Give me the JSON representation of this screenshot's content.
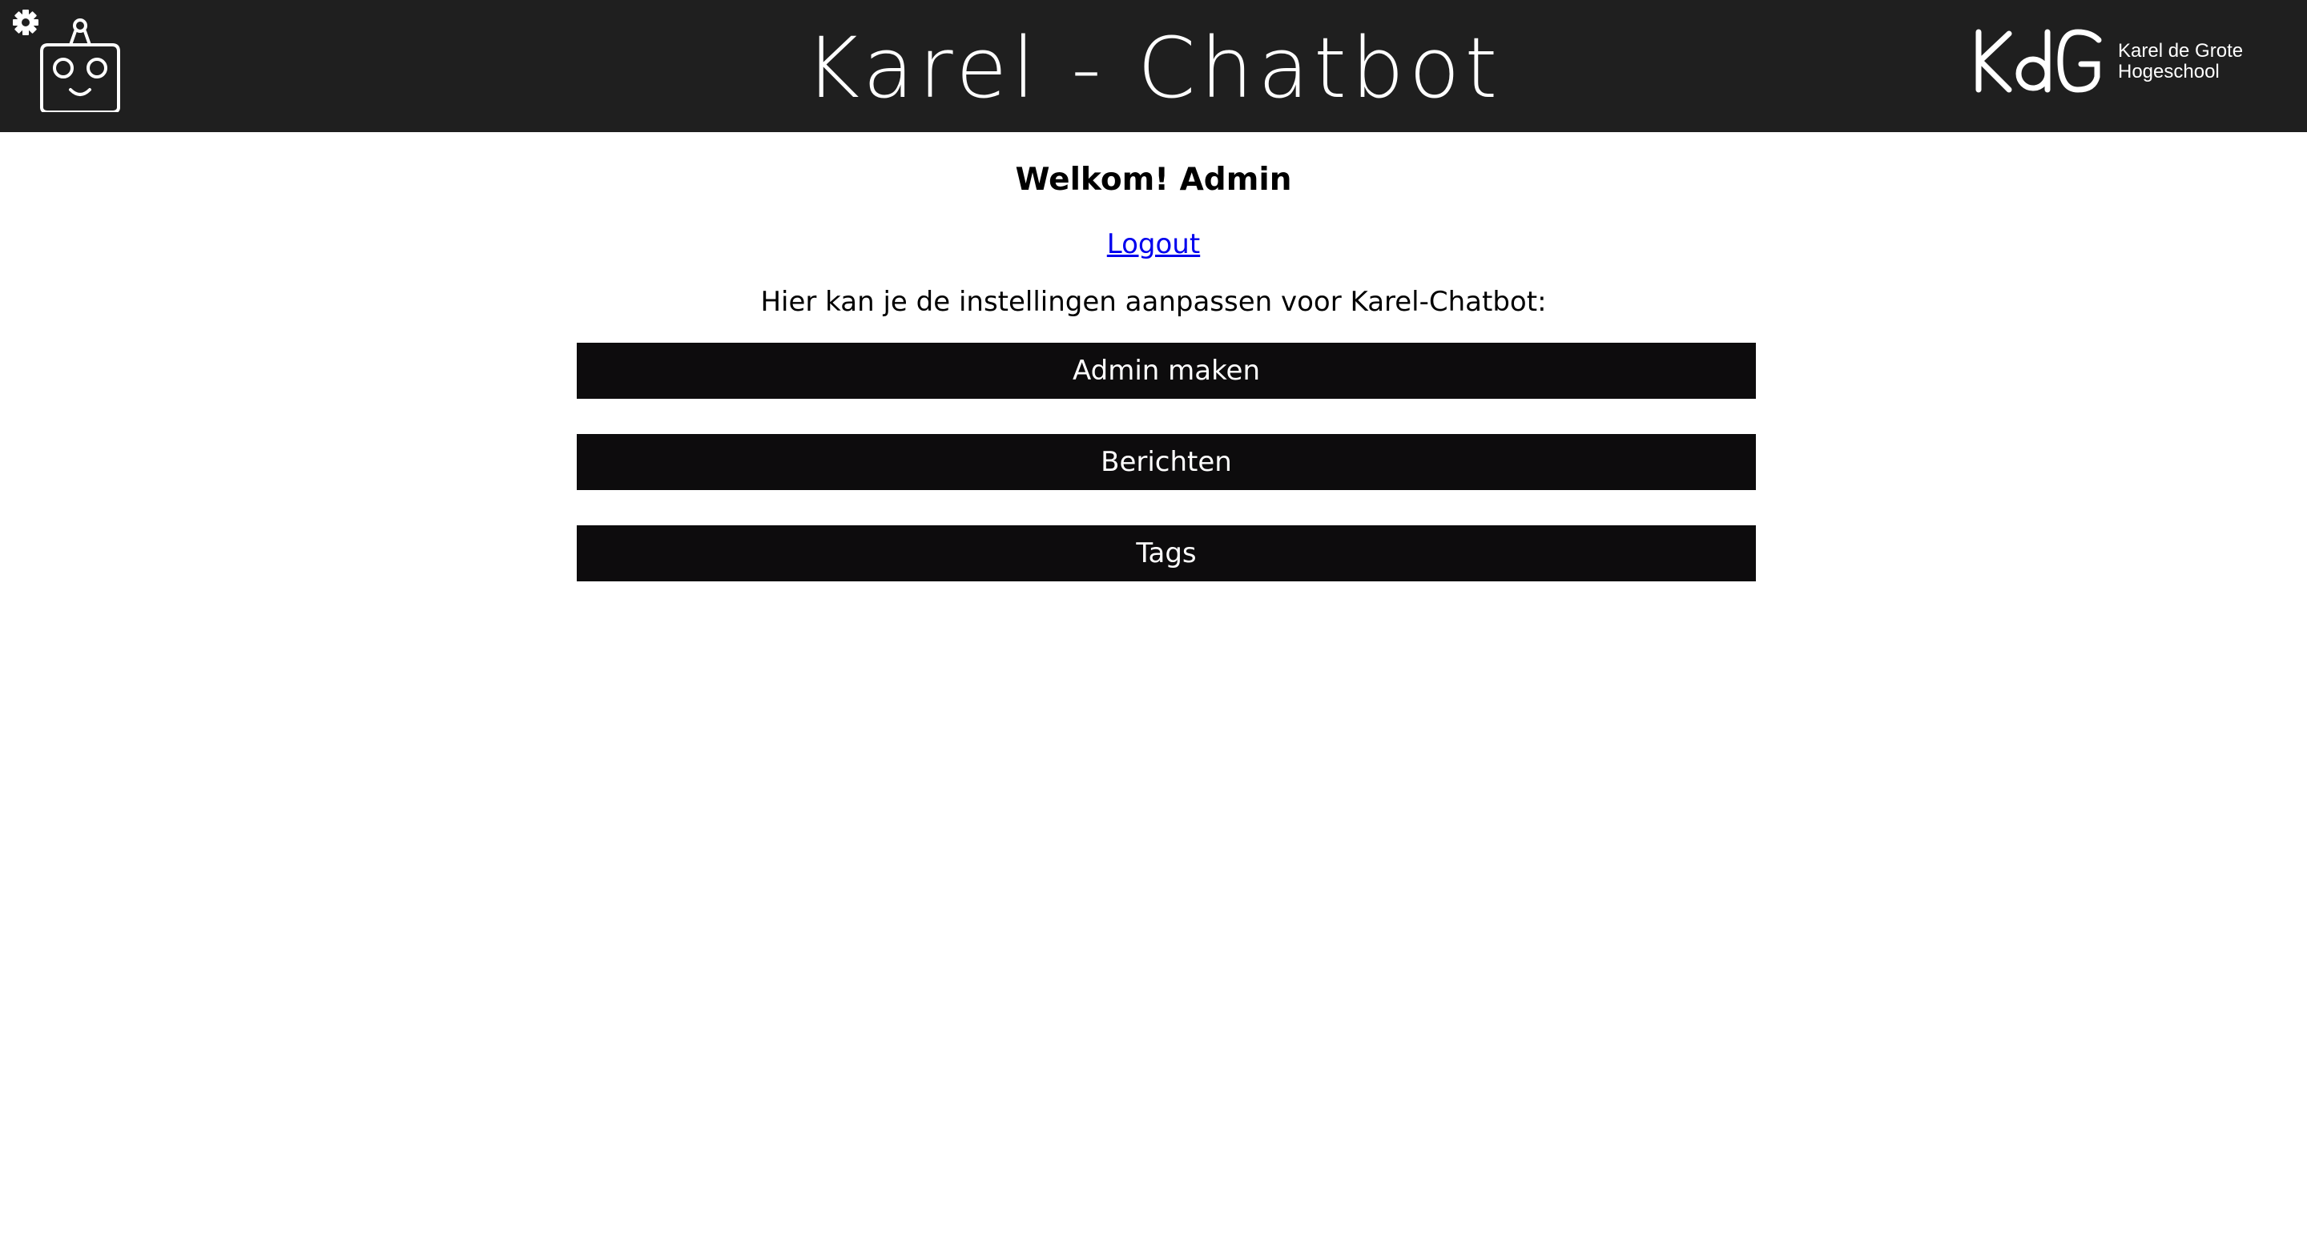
{
  "header": {
    "title": "Karel - Chatbot",
    "settings_icon": "gear-icon",
    "logo_icon": "robot-face-icon",
    "brand": {
      "mark": "KdG",
      "line1": "Karel de Grote",
      "line2": "Hogeschool"
    }
  },
  "main": {
    "welcome": "Welkom! Admin",
    "logout_label": "Logout",
    "intro": "Hier kan je de instellingen aanpassen voor Karel-Chatbot:",
    "buttons": [
      {
        "label": "Admin maken"
      },
      {
        "label": "Berichten"
      },
      {
        "label": "Tags"
      }
    ]
  },
  "colors": {
    "header_bg": "#1f1f1f",
    "button_bg": "#0d0c0d",
    "link": "#0000ee",
    "text": "#000000",
    "page_bg": "#ffffff"
  }
}
